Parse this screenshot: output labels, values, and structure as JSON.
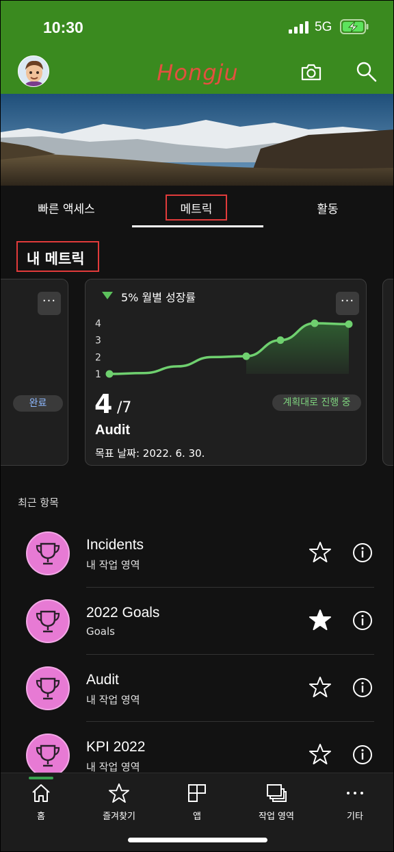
{
  "status_bar": {
    "time": "10:30",
    "network": "5G"
  },
  "header": {
    "brand": "Hongju",
    "camera_icon": "camera-icon",
    "search_icon": "search-icon",
    "avatar_icon": "avatar"
  },
  "colors": {
    "header_bg": "#3a8a1f",
    "accent": "#5cc15c",
    "badge": "#e77ad4",
    "highlight_box": "#e23b3b"
  },
  "tabs": [
    {
      "label": "빠른 액세스"
    },
    {
      "label": "메트릭",
      "selected": true
    },
    {
      "label": "활동"
    }
  ],
  "section_title": "내 메트릭",
  "left_card": {
    "status": "완료",
    "more": "···"
  },
  "metric_card": {
    "growth": "5% 월별 성장률",
    "value": "4",
    "target": "/7",
    "status": "계획대로 진행 중",
    "name": "Audit",
    "due": "목표 날짜: 2022. 6. 30.",
    "more": "···"
  },
  "chart_data": {
    "type": "area",
    "title": "",
    "xlabel": "",
    "ylabel": "",
    "y_ticks": [
      "1",
      "2",
      "3",
      "4"
    ],
    "ylim": [
      1,
      4
    ],
    "x": [
      1,
      2,
      3,
      4,
      5,
      6,
      7,
      8
    ],
    "series": [
      {
        "values": [
          1.0,
          1.05,
          1.45,
          2.0,
          2.05,
          3.0,
          4.0,
          3.95
        ]
      }
    ],
    "markers": [
      0,
      4,
      5,
      6,
      7
    ],
    "grid": false
  },
  "recent": {
    "label": "최근 항목",
    "items": [
      {
        "title": "Incidents",
        "subtitle": "내 작업 영역",
        "favorite": false
      },
      {
        "title": "2022 Goals",
        "subtitle": "Goals",
        "favorite": true
      },
      {
        "title": "Audit",
        "subtitle": "내 작업 영역",
        "favorite": false
      },
      {
        "title": "KPI 2022",
        "subtitle": "내 작업 영역",
        "favorite": false
      }
    ]
  },
  "bottom_nav": [
    {
      "label": "홈",
      "icon": "home-icon",
      "selected": true
    },
    {
      "label": "즐겨찾기",
      "icon": "star-icon"
    },
    {
      "label": "앱",
      "icon": "apps-icon"
    },
    {
      "label": "작업 영역",
      "icon": "workspaces-icon"
    },
    {
      "label": "기타",
      "icon": "more-icon"
    }
  ]
}
